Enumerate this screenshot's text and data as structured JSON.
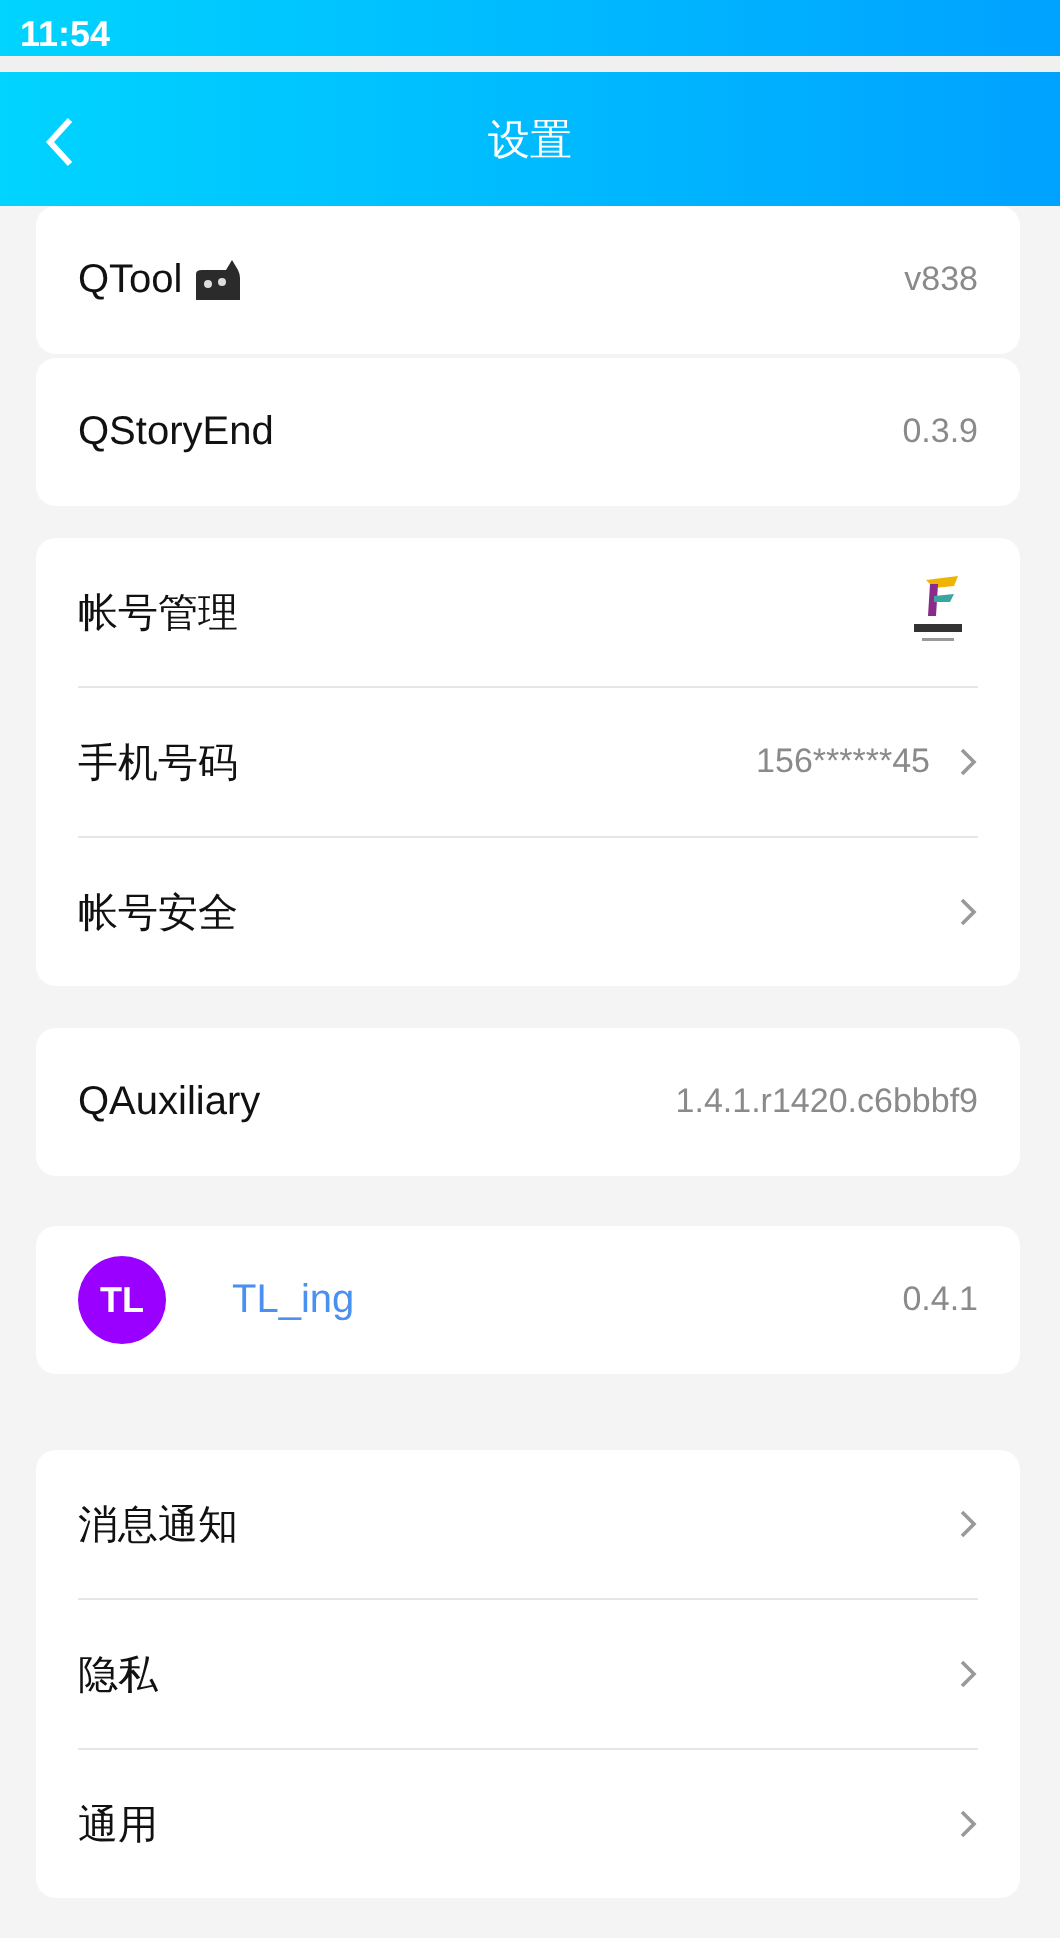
{
  "status_bar": {
    "time": "11:54"
  },
  "header": {
    "title": "设置"
  },
  "sections": [
    {
      "rows": [
        {
          "kind": "cat",
          "label": "QTool",
          "value": "v838",
          "chevron": false
        }
      ]
    },
    {
      "rows": [
        {
          "kind": "plain",
          "label": "QStoryEnd",
          "value": "0.3.9",
          "chevron": false
        }
      ]
    },
    {
      "rows": [
        {
          "kind": "logo",
          "label": "帐号管理",
          "chevron": false
        },
        {
          "kind": "plain",
          "label": "手机号码",
          "value": "156******45",
          "chevron": true
        },
        {
          "kind": "plain",
          "label": "帐号安全",
          "chevron": true
        }
      ]
    },
    {
      "rows": [
        {
          "kind": "plain",
          "label": "QAuxiliary",
          "value": "1.4.1.r1420.c6bbbf9",
          "chevron": false
        }
      ]
    },
    {
      "rows": [
        {
          "kind": "avatar",
          "avatar": "TL",
          "label": "TL_ing",
          "value": "0.4.1",
          "chevron": false
        }
      ]
    },
    {
      "rows": [
        {
          "kind": "plain",
          "label": "消息通知",
          "chevron": true
        },
        {
          "kind": "plain",
          "label": "隐私",
          "chevron": true
        },
        {
          "kind": "plain",
          "label": "通用",
          "chevron": true
        }
      ]
    }
  ]
}
